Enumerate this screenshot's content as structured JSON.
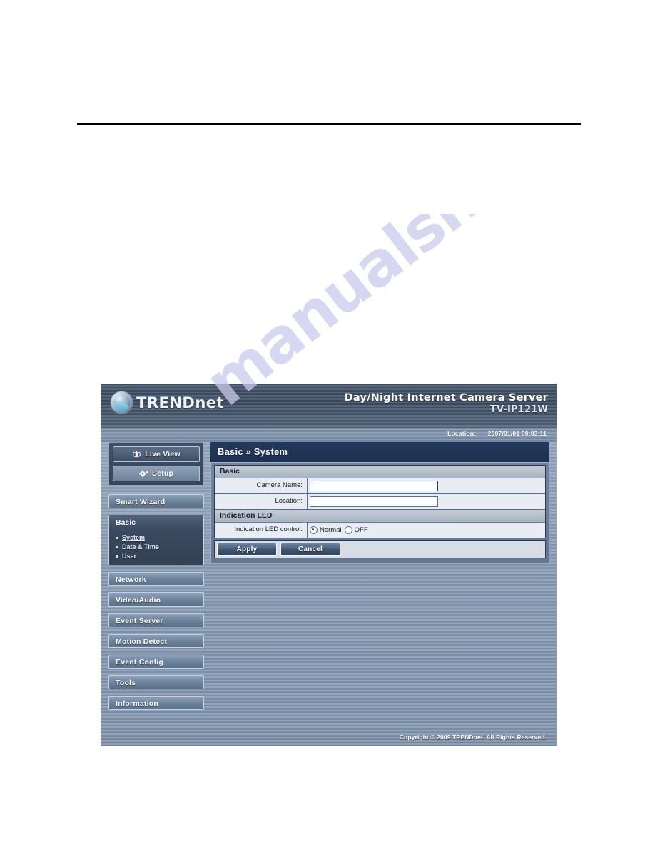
{
  "document": {
    "background": "#ffffff",
    "rule_color": "#000000"
  },
  "watermark": {
    "text": "manualshive.com",
    "color": "#c9cbee"
  },
  "device_ui": {
    "header": {
      "logo_text": "TRENDnet",
      "logo_icon": "trendnet-globe-icon",
      "product_name": "Day/Night Internet Camera Server",
      "model": "TV-IP121W"
    },
    "status_bar": {
      "location_label": "Location:",
      "timestamp": "2007/01/01 00:03:11"
    },
    "sidebar": {
      "mode_buttons": [
        {
          "label": "Live View",
          "icon": "eye-icon",
          "active": false
        },
        {
          "label": "Setup",
          "icon": "gear-icon",
          "active": true
        }
      ],
      "items": [
        {
          "label": "Smart Wizard",
          "type": "button"
        },
        {
          "label": "Basic",
          "type": "section",
          "expanded": true,
          "children": [
            {
              "label": "System",
              "active": true
            },
            {
              "label": "Date & Time",
              "active": false
            },
            {
              "label": "User",
              "active": false
            }
          ]
        },
        {
          "label": "Network",
          "type": "button"
        },
        {
          "label": "Video/Audio",
          "type": "button"
        },
        {
          "label": "Event Server",
          "type": "button"
        },
        {
          "label": "Motion Detect",
          "type": "button"
        },
        {
          "label": "Event Config",
          "type": "button"
        },
        {
          "label": "Tools",
          "type": "button"
        },
        {
          "label": "Information",
          "type": "button"
        }
      ]
    },
    "main": {
      "breadcrumb": "Basic » System",
      "sections": [
        {
          "heading": "Basic",
          "fields": [
            {
              "label": "Camera Name:",
              "type": "text",
              "value": "",
              "focused": true
            },
            {
              "label": "Location:",
              "type": "text",
              "value": "",
              "focused": false
            }
          ]
        },
        {
          "heading": "Indication LED",
          "fields": [
            {
              "label": "Indication LED control:",
              "type": "radio",
              "options": [
                {
                  "label": "Normal",
                  "selected": true
                },
                {
                  "label": "OFF",
                  "selected": false
                }
              ]
            }
          ]
        }
      ],
      "buttons": [
        {
          "label": "Apply"
        },
        {
          "label": "Cancel"
        }
      ]
    },
    "footer": {
      "copyright": "Copyright © 2009 TRENDnet. All Rights Reserved."
    }
  }
}
